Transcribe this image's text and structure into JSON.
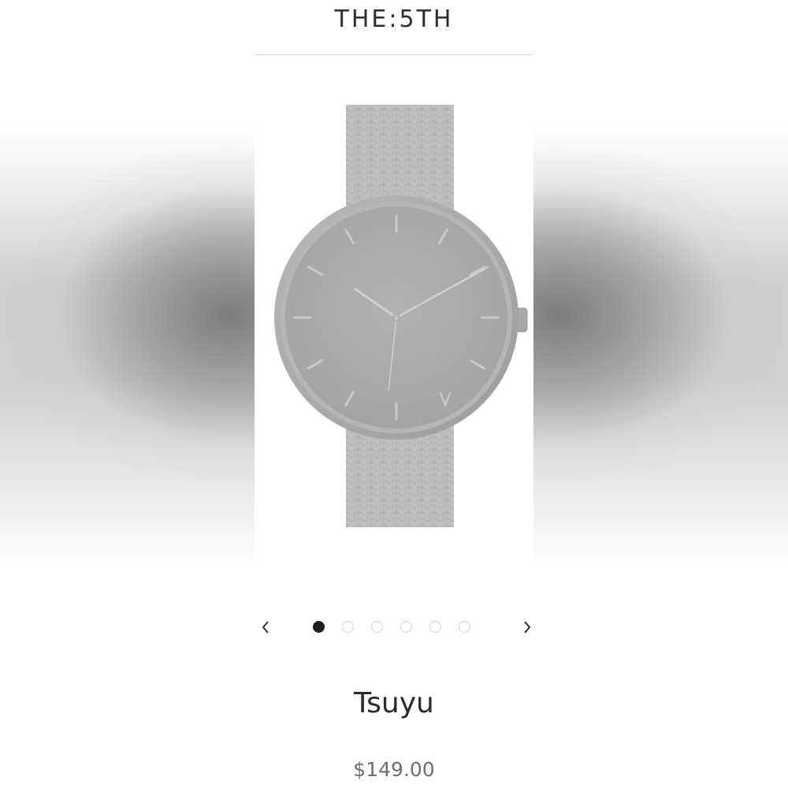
{
  "store": {
    "brand": "THE:5TH"
  },
  "product": {
    "name": "Tsuyu",
    "price": "$149.00",
    "image_alt": "Tsuyu watch with grey leather strap"
  },
  "carousel": {
    "total_slides": 6,
    "current_slide": 1,
    "prev_icon": "chevron-left-icon",
    "next_icon": "chevron-right-icon"
  },
  "colors": {
    "watch_grey": "#a9a9a9",
    "text_dark": "#2a2a2a",
    "price_grey": "#6e6e6e",
    "active_dot": "#1e1e1e"
  }
}
